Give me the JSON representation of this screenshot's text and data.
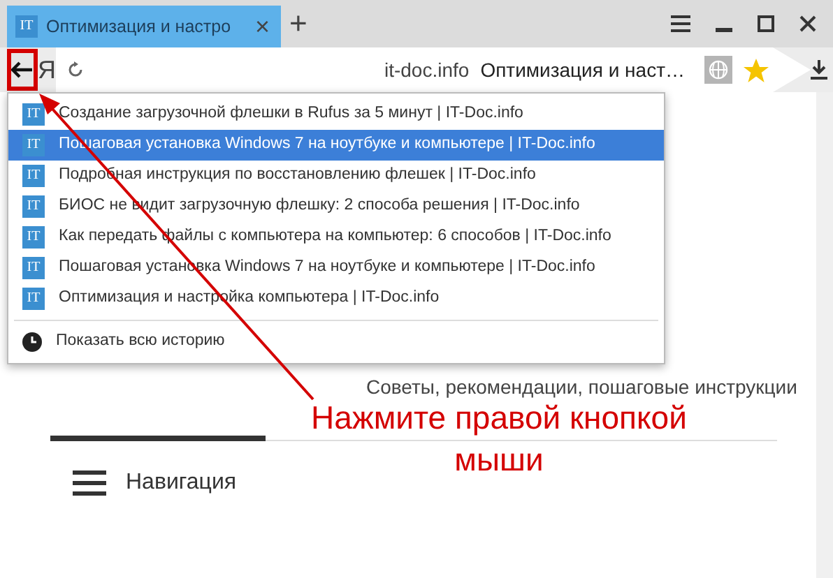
{
  "tab": {
    "favicon": "IT",
    "title": "Оптимизация и настро",
    "close": "×",
    "selected": true
  },
  "new_tab": "+",
  "toolbar": {
    "yandex": "Я",
    "domain": "it-doc.info",
    "page_title": "Оптимизация и наст…",
    "bookmarked": true
  },
  "history_menu": {
    "items": [
      {
        "favicon": "IT",
        "title": "Создание загрузочной флешки в Rufus за 5 минут | IT-Doc.info",
        "selected": false
      },
      {
        "favicon": "IT",
        "title": "Пошаговая установка Windows 7 на ноутбуке и компьютере | IT-Doc.info",
        "selected": true
      },
      {
        "favicon": "IT",
        "title": "Подробная инструкция по восстановлению флешек | IT-Doc.info",
        "selected": false
      },
      {
        "favicon": "IT",
        "title": "БИОС не видит загрузочную флешку: 2 способа решения | IT-Doc.info",
        "selected": false
      },
      {
        "favicon": "IT",
        "title": "Как передать файлы с компьютера на компьютер: 6 способов | IT-Doc.info",
        "selected": false
      },
      {
        "favicon": "IT",
        "title": "Пошаговая установка Windows 7 на ноутбуке и компьютере | IT-Doc.info",
        "selected": false
      },
      {
        "favicon": "IT",
        "title": "Оптимизация и настройка компьютера | IT-Doc.info",
        "selected": false
      }
    ],
    "show_all": "Показать всю историю"
  },
  "page": {
    "tagline": "Советы, рекомендации, пошаговые инструкции",
    "nav_label": "Навигация"
  },
  "annotation": {
    "text": "Нажмите правой кнопкой мыши"
  }
}
